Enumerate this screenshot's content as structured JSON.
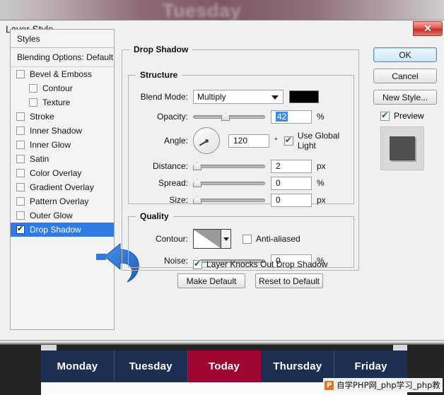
{
  "window": {
    "title": "Layer Style",
    "close_label": "✕",
    "background_word": "Tuesday"
  },
  "styles_panel": {
    "header": "Styles",
    "blending_options": "Blending Options: Default",
    "items": [
      {
        "label": "Bevel & Emboss",
        "checked": false,
        "indent": false,
        "selected": false
      },
      {
        "label": "Contour",
        "checked": false,
        "indent": true,
        "selected": false
      },
      {
        "label": "Texture",
        "checked": false,
        "indent": true,
        "selected": false
      },
      {
        "label": "Stroke",
        "checked": false,
        "indent": false,
        "selected": false
      },
      {
        "label": "Inner Shadow",
        "checked": false,
        "indent": false,
        "selected": false
      },
      {
        "label": "Inner Glow",
        "checked": false,
        "indent": false,
        "selected": false
      },
      {
        "label": "Satin",
        "checked": false,
        "indent": false,
        "selected": false
      },
      {
        "label": "Color Overlay",
        "checked": false,
        "indent": false,
        "selected": false
      },
      {
        "label": "Gradient Overlay",
        "checked": false,
        "indent": false,
        "selected": false
      },
      {
        "label": "Pattern Overlay",
        "checked": false,
        "indent": false,
        "selected": false
      },
      {
        "label": "Outer Glow",
        "checked": false,
        "indent": false,
        "selected": false
      },
      {
        "label": "Drop Shadow",
        "checked": true,
        "indent": false,
        "selected": true
      }
    ]
  },
  "drop_shadow": {
    "group_title": "Drop Shadow",
    "structure": {
      "title": "Structure",
      "blend_mode_label": "Blend Mode:",
      "blend_mode_value": "Multiply",
      "shadow_color": "#000000",
      "opacity_label": "Opacity:",
      "opacity_value": "42",
      "opacity_unit": "%",
      "angle_label": "Angle:",
      "angle_value": "120",
      "angle_unit": "°",
      "use_global_light": "Use Global Light",
      "use_global_light_checked": true,
      "distance_label": "Distance:",
      "distance_value": "2",
      "distance_unit": "px",
      "spread_label": "Spread:",
      "spread_value": "0",
      "spread_unit": "%",
      "size_label": "Size:",
      "size_value": "0",
      "size_unit": "px"
    },
    "quality": {
      "title": "Quality",
      "contour_label": "Contour:",
      "anti_aliased_label": "Anti-aliased",
      "anti_aliased_checked": false,
      "noise_label": "Noise:",
      "noise_value": "0",
      "noise_unit": "%"
    },
    "knockout_label": "Layer Knocks Out Drop Shadow",
    "knockout_checked": true,
    "make_default_label": "Make Default",
    "reset_default_label": "Reset to Default"
  },
  "actions": {
    "ok_label": "OK",
    "cancel_label": "Cancel",
    "new_style_label": "New Style...",
    "preview_label": "Preview",
    "preview_checked": true
  },
  "day_tabs": {
    "items": [
      {
        "label": "Monday",
        "active": false
      },
      {
        "label": "Tuesday",
        "active": false
      },
      {
        "label": "Today",
        "active": true
      },
      {
        "label": "Thursday",
        "active": false
      },
      {
        "label": "Friday",
        "active": false
      }
    ],
    "active_color": "#9e0430",
    "inactive_color": "#1c2e51"
  },
  "watermark": {
    "logo": "P",
    "text": "自学PHP网_php学习_php教"
  },
  "annotation": {
    "arrow_color": "#2e72d2",
    "points_to": "Drop Shadow"
  }
}
